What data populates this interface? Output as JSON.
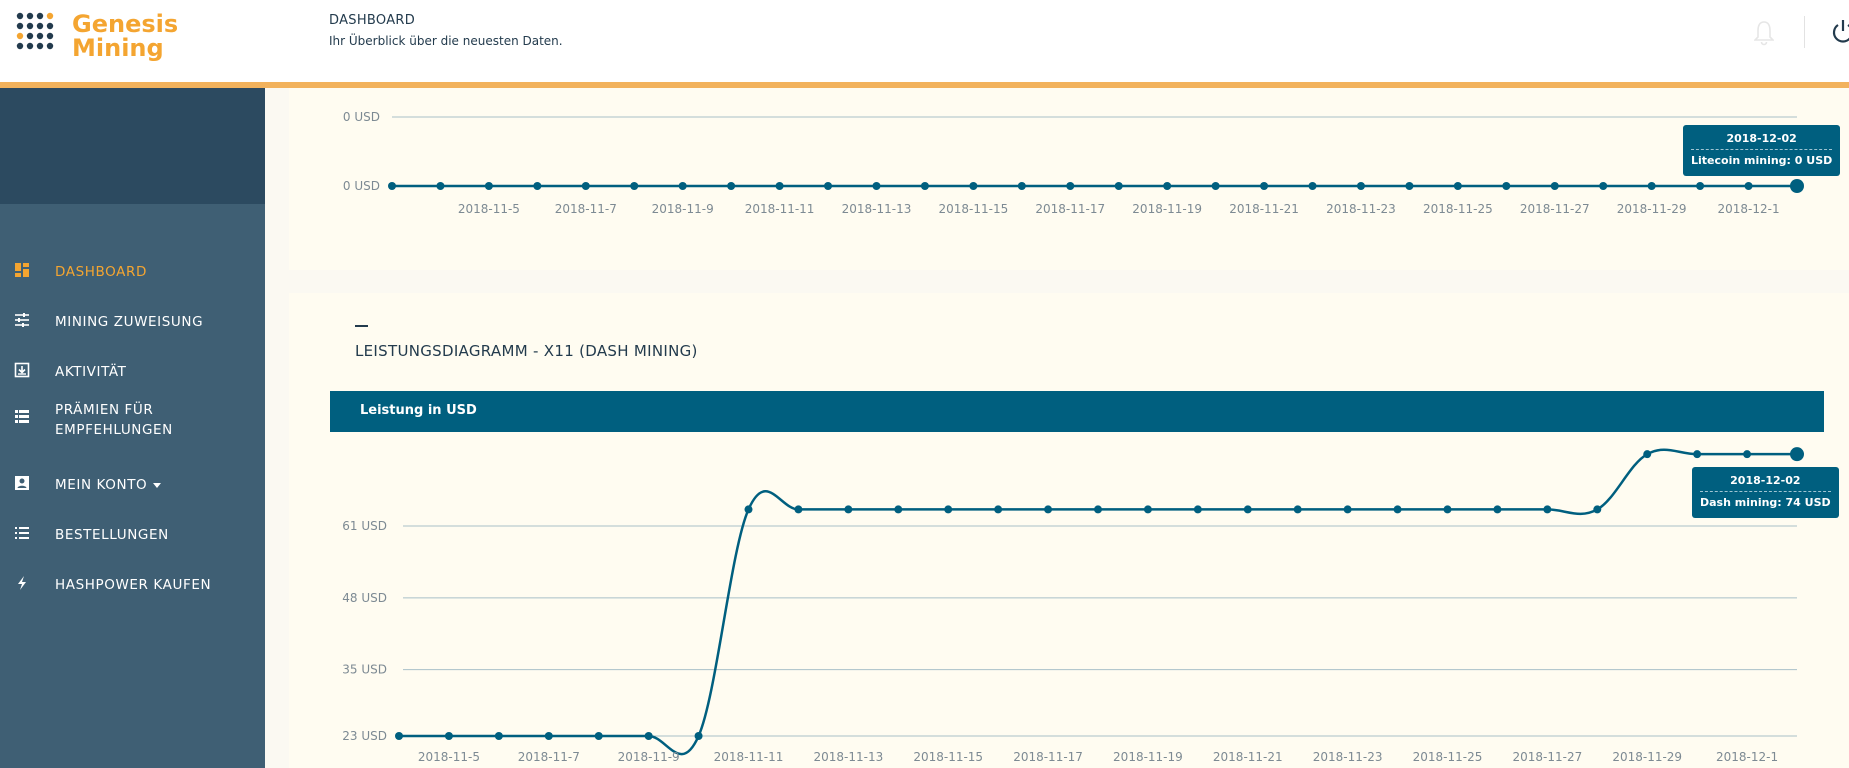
{
  "app": {
    "logo_line1": "Genesis",
    "logo_line2": "Mining"
  },
  "header": {
    "title": "DASHBOARD",
    "subtitle": "Ihr Überblick über die neuesten Daten."
  },
  "sidebar": {
    "items": [
      {
        "label": "DASHBOARD",
        "icon": "dashboard-icon",
        "active": true
      },
      {
        "label": "MINING ZUWEISUNG",
        "icon": "sliders-icon"
      },
      {
        "label": "AKTIVITÄT",
        "icon": "download-box-icon"
      },
      {
        "label": "PRÄMIEN FÜR EMPFEHLUNGEN",
        "icon": "list-icon"
      },
      {
        "label": "MEIN KONTO",
        "icon": "account-box-icon",
        "has_dropdown": true
      },
      {
        "label": "BESTELLUNGEN",
        "icon": "list-icon"
      },
      {
        "label": "HASHPOWER KAUFEN",
        "icon": "bolt-icon"
      }
    ]
  },
  "colors": {
    "accent": "#f4a531",
    "line": "#005f7f",
    "sidebar": "#3f5f74",
    "sidebar_top": "#2c4a60"
  },
  "chart_data": [
    {
      "type": "line",
      "title": "",
      "ylabel": "",
      "y_ticks": [
        "0 USD",
        "0 USD"
      ],
      "x_ticks": [
        "2018-11-5",
        "2018-11-7",
        "2018-11-9",
        "2018-11-11",
        "2018-11-13",
        "2018-11-15",
        "2018-11-17",
        "2018-11-19",
        "2018-11-21",
        "2018-11-23",
        "2018-11-25",
        "2018-11-27",
        "2018-11-29",
        "2018-12-1"
      ],
      "x_start": "2018-11-03",
      "x_end": "2018-12-02",
      "series": [
        {
          "name": "Litecoin mining",
          "values": [
            0,
            0,
            0,
            0,
            0,
            0,
            0,
            0,
            0,
            0,
            0,
            0,
            0,
            0,
            0,
            0,
            0,
            0,
            0,
            0,
            0,
            0,
            0,
            0,
            0,
            0,
            0,
            0,
            0,
            0
          ]
        }
      ],
      "tooltip": {
        "date": "2018-12-02",
        "text": "Litecoin mining: 0 USD"
      }
    },
    {
      "type": "line",
      "title": "LEISTUNGSDIAGRAMM - X11 (DASH MINING)",
      "panel_header": "Leistung in USD",
      "y_ticks": [
        "61 USD",
        "48 USD",
        "35 USD",
        "23 USD"
      ],
      "y_tick_values": [
        61,
        48,
        35,
        23
      ],
      "x_ticks": [
        "2018-11-5",
        "2018-11-7",
        "2018-11-9",
        "2018-11-11",
        "2018-11-13",
        "2018-11-15",
        "2018-11-17",
        "2018-11-19",
        "2018-11-21",
        "2018-11-23",
        "2018-11-25",
        "2018-11-27",
        "2018-11-29",
        "2018-12-1"
      ],
      "x_start": "2018-11-04",
      "x_end": "2018-12-02",
      "series": [
        {
          "name": "Dash mining",
          "values": [
            23,
            23,
            23,
            23,
            23,
            23,
            23,
            64,
            64,
            64,
            64,
            64,
            64,
            64,
            64,
            64,
            64,
            64,
            64,
            64,
            64,
            64,
            64,
            64,
            64,
            74,
            74,
            74,
            74
          ]
        }
      ],
      "tooltip": {
        "date": "2018-12-02",
        "text": "Dash mining: 74 USD"
      }
    }
  ]
}
